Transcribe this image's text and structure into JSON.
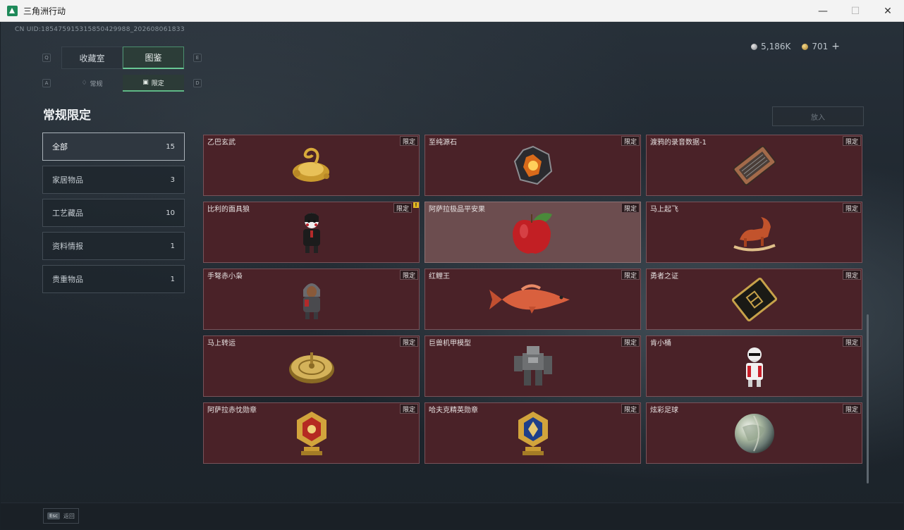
{
  "window": {
    "title": "三角洲行动",
    "minimize": "—",
    "maximize": "☐",
    "close": "✕"
  },
  "uid": "CN UID:1854759153158504299​88_202608061833",
  "currency": [
    {
      "icon": "silver-coin-icon",
      "value": "5,186K"
    },
    {
      "icon": "gold-coin-icon",
      "value": "701"
    }
  ],
  "currency_plus": "+",
  "tabs": {
    "key_left": "Q",
    "key_right": "E",
    "items": [
      {
        "label": "收藏室",
        "active": false
      },
      {
        "label": "图鉴",
        "active": true
      }
    ]
  },
  "subtabs": {
    "key_left": "A",
    "key_right": "D",
    "items": [
      {
        "icon": "flame-icon",
        "label": "常规",
        "active": false
      },
      {
        "icon": "badge-icon",
        "label": "限定",
        "active": true
      }
    ]
  },
  "section_title": "常规限定",
  "categories": [
    {
      "label": "全部",
      "count": "15",
      "active": true
    },
    {
      "label": "家居物品",
      "count": "3",
      "active": false
    },
    {
      "label": "工艺藏品",
      "count": "10",
      "active": false
    },
    {
      "label": "资料情报",
      "count": "1",
      "active": false
    },
    {
      "label": "贵重物品",
      "count": "1",
      "active": false
    }
  ],
  "put_in_label": "放入",
  "tag_label": "限定",
  "items": [
    {
      "name": "乙巴玄武",
      "art": "golden-turtle"
    },
    {
      "name": "至纯源石",
      "art": "source-stone"
    },
    {
      "name": "渡鸦的录音数据-1",
      "art": "recording-tape"
    },
    {
      "name": "比利的面具狼",
      "art": "puppet-figure",
      "alert": "!"
    },
    {
      "name": "阿萨拉极品平安果",
      "art": "apple",
      "highlight": true
    },
    {
      "name": "马上起飞",
      "art": "rocking-horse"
    },
    {
      "name": "手弩赤小枭",
      "art": "hooded-figure"
    },
    {
      "name": "红鲤王",
      "art": "red-carp"
    },
    {
      "name": "勇者之证",
      "art": "gold-card"
    },
    {
      "name": "马上转运",
      "art": "golden-compass"
    },
    {
      "name": "巨兽机甲模型",
      "art": "mech-model"
    },
    {
      "name": "肯小桶",
      "art": "bucket-figure"
    },
    {
      "name": "阿萨拉赤忱勋章",
      "art": "red-medal"
    },
    {
      "name": "哈夫克精英勋章",
      "art": "blue-medal"
    },
    {
      "name": "炫彩足球",
      "art": "iridescent-ball"
    }
  ],
  "esc": {
    "key": "Esc",
    "label": "返回"
  }
}
